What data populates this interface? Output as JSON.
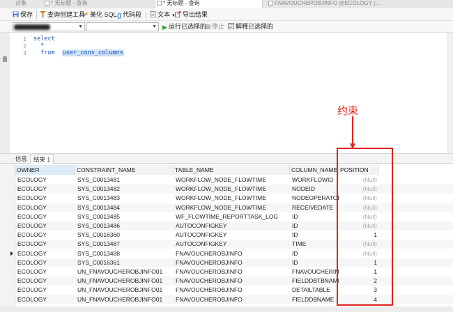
{
  "tabs": [
    {
      "label": "对象",
      "active": false
    },
    {
      "label": "* 无标题 - 查询",
      "active": false
    },
    {
      "label": "* 无标题 - 查询",
      "active": true
    },
    {
      "label": "FNAVOUCHEROBJINFO @ECOLOGY (...",
      "active": false
    }
  ],
  "toolbar": {
    "save": "保存",
    "query_builder": "查询创建工具",
    "beautify": "美化 SQL",
    "snippet": "代码段",
    "text": "文本",
    "export": "导出结果"
  },
  "runbar": {
    "run_selected": "运行已选择的",
    "stop": "停止",
    "explain": "解释已选择的"
  },
  "editor": {
    "line_numbers": [
      "1",
      "2",
      "3"
    ],
    "lines": {
      "l1": "select",
      "l2": "*",
      "l3_kw": "from",
      "l3_table": "user_cons_columns"
    }
  },
  "result_tabs": [
    {
      "label": "信息",
      "active": false
    },
    {
      "label": "结果 1",
      "active": true
    }
  ],
  "grid": {
    "columns": [
      "OWNER",
      "CONSTRAINT_NAME",
      "TABLE_NAME",
      "COLUMN_NAME",
      "POSITION"
    ],
    "rows": [
      [
        "ECOLOGY",
        "SYS_C0013481",
        "WORKFLOW_NODE_FLOWTIME",
        "WORKFLOWID",
        "(Null)"
      ],
      [
        "ECOLOGY",
        "SYS_C0013482",
        "WORKFLOW_NODE_FLOWTIME",
        "NODEID",
        "(Null)"
      ],
      [
        "ECOLOGY",
        "SYS_C0013483",
        "WORKFLOW_NODE_FLOWTIME",
        "NODEOPERATOR",
        "(Null)"
      ],
      [
        "ECOLOGY",
        "SYS_C0013484",
        "WORKFLOW_NODE_FLOWTIME",
        "RECEIVEDATE",
        "(Null)"
      ],
      [
        "ECOLOGY",
        "SYS_C0013485",
        "WF_FLOWTIME_REPORTTASK_LOG",
        "ID",
        "(Null)"
      ],
      [
        "ECOLOGY",
        "SYS_C0013486",
        "AUTOCONFIGKEY",
        "ID",
        "(Null)"
      ],
      [
        "ECOLOGY",
        "SYS_C0016360",
        "AUTOCONFIGKEY",
        "ID",
        "1"
      ],
      [
        "ECOLOGY",
        "SYS_C0013487",
        "AUTOCONFIGKEY",
        "TIME",
        "(Null)"
      ],
      [
        "ECOLOGY",
        "SYS_C0013488",
        "FNAVOUCHEROBJINFO",
        "ID",
        "(Null)"
      ],
      [
        "ECOLOGY",
        "SYS_C0016361",
        "FNAVOUCHEROBJINFO",
        "ID",
        "1"
      ],
      [
        "ECOLOGY",
        "UN_FNAVOUCHEROBJINFO01",
        "FNAVOUCHEROBJINFO",
        "FNAVOUCHERINIT",
        "1"
      ],
      [
        "ECOLOGY",
        "UN_FNAVOUCHEROBJINFO01",
        "FNAVOUCHEROBJINFO",
        "FIELDDBTBNAME",
        "2"
      ],
      [
        "ECOLOGY",
        "UN_FNAVOUCHEROBJINFO01",
        "FNAVOUCHEROBJINFO",
        "DETAILTABLE",
        "3"
      ],
      [
        "ECOLOGY",
        "UN_FNAVOUCHEROBJINFO01",
        "FNAVOUCHEROBJINFO",
        "FIELDDBNAME",
        "4"
      ]
    ],
    "current_row": 8
  },
  "annotation": {
    "label": "约束",
    "color": "#e0221b"
  },
  "icons": {
    "save": "save-icon",
    "query_builder": "query-builder-icon",
    "beautify": "beautify-icon",
    "snippet": "code-snippet-icon",
    "text": "text-icon",
    "export": "export-icon",
    "run": "play-icon",
    "stop": "stop-icon",
    "explain": "explain-icon"
  }
}
